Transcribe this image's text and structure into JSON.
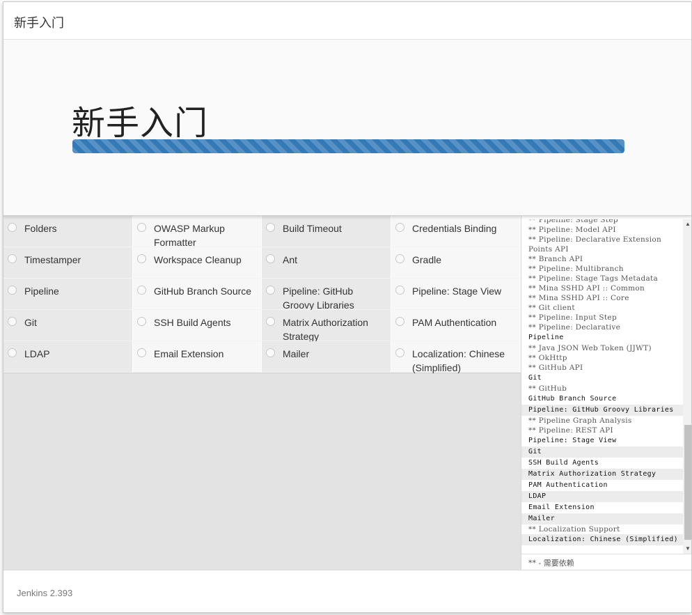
{
  "window": {
    "title": "新手入门"
  },
  "hero": {
    "title": "新手入门",
    "progress": 1.0
  },
  "plugins": [
    "Folders",
    "OWASP Markup Formatter",
    "Build Timeout",
    "Credentials Binding",
    "Timestamper",
    "Workspace Cleanup",
    "Ant",
    "Gradle",
    "Pipeline",
    "GitHub Branch Source",
    "Pipeline: GitHub Groovy Libraries",
    "Pipeline: Stage View",
    "Git",
    "SSH Build Agents",
    "Matrix Authorization Strategy",
    "PAM Authentication",
    "LDAP",
    "Email Extension",
    "Mailer",
    "Localization: Chinese (Simplified)"
  ],
  "log": [
    {
      "text": "** Pipeline: Stage Step",
      "kind": "dep"
    },
    {
      "text": "** Pipeline: Model API",
      "kind": "dep"
    },
    {
      "text": "** Pipeline: Declarative Extension",
      "kind": "dep"
    },
    {
      "text": "Points API",
      "kind": "dep"
    },
    {
      "text": "** Branch API",
      "kind": "dep"
    },
    {
      "text": "** Pipeline: Multibranch",
      "kind": "dep"
    },
    {
      "text": "** Pipeline: Stage Tags Metadata",
      "kind": "dep"
    },
    {
      "text": "** Mina SSHD API :: Common",
      "kind": "dep"
    },
    {
      "text": "** Mina SSHD API :: Core",
      "kind": "dep"
    },
    {
      "text": "** Git client",
      "kind": "dep"
    },
    {
      "text": "** Pipeline: Input Step",
      "kind": "dep"
    },
    {
      "text": "** Pipeline: Declarative",
      "kind": "dep"
    },
    {
      "text": "Pipeline",
      "kind": "main"
    },
    {
      "text": "** Java JSON Web Token (JJWT)",
      "kind": "dep"
    },
    {
      "text": "** OkHttp",
      "kind": "dep"
    },
    {
      "text": "** GitHub API",
      "kind": "dep"
    },
    {
      "text": "Git",
      "kind": "main"
    },
    {
      "text": "** GitHub",
      "kind": "dep"
    },
    {
      "text": "GitHub Branch Source",
      "kind": "main"
    },
    {
      "text": "Pipeline: GitHub Groovy Libraries",
      "kind": "main alt"
    },
    {
      "text": "** Pipeline Graph Analysis",
      "kind": "dep"
    },
    {
      "text": "** Pipeline: REST API",
      "kind": "dep"
    },
    {
      "text": "Pipeline: Stage View",
      "kind": "main"
    },
    {
      "text": "Git",
      "kind": "main alt"
    },
    {
      "text": "SSH Build Agents",
      "kind": "main"
    },
    {
      "text": "Matrix Authorization Strategy",
      "kind": "main alt"
    },
    {
      "text": "PAM Authentication",
      "kind": "main"
    },
    {
      "text": "LDAP",
      "kind": "main alt"
    },
    {
      "text": "Email Extension",
      "kind": "main"
    },
    {
      "text": "Mailer",
      "kind": "main alt"
    },
    {
      "text": "** Localization Support",
      "kind": "dep"
    },
    {
      "text": "Localization: Chinese (Simplified)",
      "kind": "main alt"
    }
  ],
  "log_footer": "** - 需要依赖",
  "footer": {
    "version": "Jenkins 2.393"
  }
}
